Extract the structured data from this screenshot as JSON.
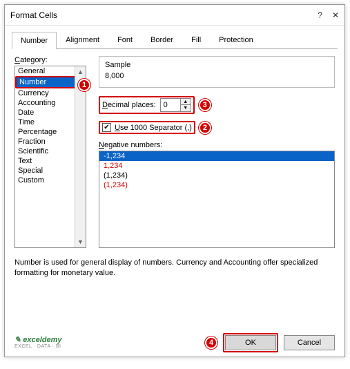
{
  "title": "Format Cells",
  "tabs": [
    "Number",
    "Alignment",
    "Font",
    "Border",
    "Fill",
    "Protection"
  ],
  "active_tab": 0,
  "category_label": "Category:",
  "categories": [
    "General",
    "Number",
    "Currency",
    "Accounting",
    "Date",
    "Time",
    "Percentage",
    "Fraction",
    "Scientific",
    "Text",
    "Special",
    "Custom"
  ],
  "selected_category": 1,
  "sample_label": "Sample",
  "sample_value": "8,000",
  "decimal_label": "Decimal places:",
  "decimal_value": "0",
  "separator_label": "Use 1000 Separator (,)",
  "separator_checked": true,
  "negative_label": "Negative numbers:",
  "negative_numbers": [
    {
      "text": "-1,234",
      "color": "normal",
      "selected": true
    },
    {
      "text": "1,234",
      "color": "red",
      "selected": false
    },
    {
      "text": "(1,234)",
      "color": "normal",
      "selected": false
    },
    {
      "text": "(1,234)",
      "color": "red",
      "selected": false
    }
  ],
  "description": "Number is used for general display of numbers.  Currency and Accounting offer specialized formatting for monetary value.",
  "ok": "OK",
  "cancel": "Cancel",
  "callouts": {
    "c1": "1",
    "c2": "2",
    "c3": "3",
    "c4": "4"
  },
  "logo_main": "exceldemy",
  "logo_sub": "EXCEL · DATA · BI"
}
